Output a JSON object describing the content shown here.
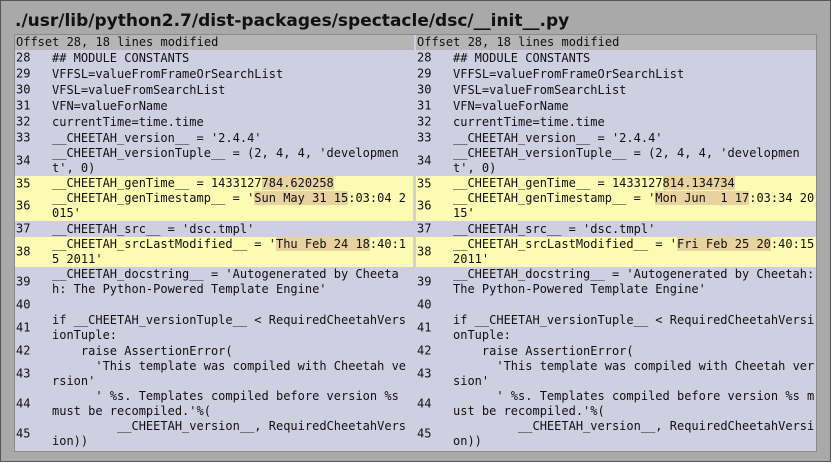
{
  "title": "./usr/lib/python2.7/dist-packages/spectacle/dsc/__init__.py",
  "left": {
    "offset": "Offset 28, 18 lines modified",
    "lines": [
      {
        "n": "28",
        "text": "## MODULE CONSTANTS"
      },
      {
        "n": "29",
        "text": "VFFSL=valueFromFrameOrSearchList"
      },
      {
        "n": "30",
        "text": "VFSL=valueFromSearchList"
      },
      {
        "n": "31",
        "text": "VFN=valueForName"
      },
      {
        "n": "32",
        "text": "currentTime=time.time"
      },
      {
        "n": "33",
        "text": "__CHEETAH_version__ = '2.4.4'"
      },
      {
        "n": "34",
        "text": "__CHEETAH_versionTuple__ = (2, 4, 4, 'development', 0)"
      },
      {
        "n": "35",
        "pre": "__CHEETAH_genTime__ = 1433127",
        "chg": "784.620258",
        "post": ""
      },
      {
        "n": "36",
        "pre": "__CHEETAH_genTimestamp__ = '",
        "chg": "Sun May 31 15",
        "post": ":03:04 2015'"
      },
      {
        "n": "37",
        "text": "__CHEETAH_src__ = 'dsc.tmpl'"
      },
      {
        "n": "38",
        "pre": "__CHEETAH_srcLastModified__ = '",
        "chg": "Thu Feb 24 18",
        "post": ":40:15 2011'"
      },
      {
        "n": "39",
        "text": "__CHEETAH_docstring__ = 'Autogenerated by Cheetah: The Python-Powered Template Engine'"
      },
      {
        "n": "40",
        "text": ""
      },
      {
        "n": "41",
        "text": "if __CHEETAH_versionTuple__ < RequiredCheetahVersionTuple:"
      },
      {
        "n": "42",
        "text": "    raise AssertionError("
      },
      {
        "n": "43",
        "text": "      'This template was compiled with Cheetah version'"
      },
      {
        "n": "44",
        "text": "      ' %s. Templates compiled before version %s must be recompiled.'%("
      },
      {
        "n": "45",
        "text": "         __CHEETAH_version__, RequiredCheetahVersion))"
      }
    ]
  },
  "right": {
    "offset": "Offset 28, 18 lines modified",
    "lines": [
      {
        "n": "28",
        "text": "## MODULE CONSTANTS"
      },
      {
        "n": "29",
        "text": "VFFSL=valueFromFrameOrSearchList"
      },
      {
        "n": "30",
        "text": "VFSL=valueFromSearchList"
      },
      {
        "n": "31",
        "text": "VFN=valueForName"
      },
      {
        "n": "32",
        "text": "currentTime=time.time"
      },
      {
        "n": "33",
        "text": "__CHEETAH_version__ = '2.4.4'"
      },
      {
        "n": "34",
        "text": "__CHEETAH_versionTuple__ = (2, 4, 4, 'development', 0)"
      },
      {
        "n": "35",
        "pre": "__CHEETAH_genTime__ = 1433127",
        "chg": "814.134734",
        "post": ""
      },
      {
        "n": "36",
        "pre": "__CHEETAH_genTimestamp__ = '",
        "chg": "Mon Jun  1 17",
        "post": ":03:34 2015'"
      },
      {
        "n": "37",
        "text": "__CHEETAH_src__ = 'dsc.tmpl'"
      },
      {
        "n": "38",
        "pre": "__CHEETAH_srcLastModified__ = '",
        "chg": "Fri Feb 25 20",
        "post": ":40:15 2011'"
      },
      {
        "n": "39",
        "text": "__CHEETAH_docstring__ = 'Autogenerated by Cheetah: The Python-Powered Template Engine'"
      },
      {
        "n": "40",
        "text": ""
      },
      {
        "n": "41",
        "text": "if __CHEETAH_versionTuple__ < RequiredCheetahVersionTuple:"
      },
      {
        "n": "42",
        "text": "    raise AssertionError("
      },
      {
        "n": "43",
        "text": "      'This template was compiled with Cheetah version'"
      },
      {
        "n": "44",
        "text": "      ' %s. Templates compiled before version %s must be recompiled.'%("
      },
      {
        "n": "45",
        "text": "         __CHEETAH_version__, RequiredCheetahVersion))"
      }
    ]
  }
}
